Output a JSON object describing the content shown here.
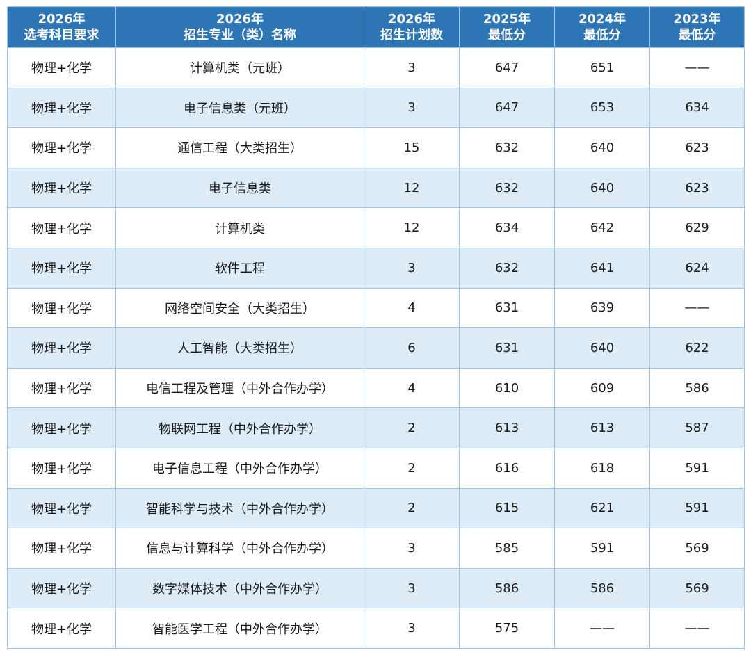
{
  "table": {
    "headers": [
      {
        "line1": "2026年",
        "line2": "选考科目要求"
      },
      {
        "line1": "2026年",
        "line2": "招生专业（类）名称"
      },
      {
        "line1": "2026年",
        "line2": "招生计划数"
      },
      {
        "line1": "2025年",
        "line2": "最低分"
      },
      {
        "line1": "2024年",
        "line2": "最低分"
      },
      {
        "line1": "2023年",
        "line2": "最低分"
      }
    ],
    "rows": [
      [
        "物理+化学",
        "计算机类（元班）",
        "3",
        "647",
        "651",
        "——"
      ],
      [
        "物理+化学",
        "电子信息类（元班）",
        "3",
        "647",
        "653",
        "634"
      ],
      [
        "物理+化学",
        "通信工程（大类招生）",
        "15",
        "632",
        "640",
        "623"
      ],
      [
        "物理+化学",
        "电子信息类",
        "12",
        "632",
        "640",
        "623"
      ],
      [
        "物理+化学",
        "计算机类",
        "12",
        "634",
        "642",
        "629"
      ],
      [
        "物理+化学",
        "软件工程",
        "3",
        "632",
        "641",
        "624"
      ],
      [
        "物理+化学",
        "网络空间安全（大类招生）",
        "4",
        "631",
        "639",
        "——"
      ],
      [
        "物理+化学",
        "人工智能（大类招生）",
        "6",
        "631",
        "640",
        "622"
      ],
      [
        "物理+化学",
        "电信工程及管理（中外合作办学）",
        "4",
        "610",
        "609",
        "586"
      ],
      [
        "物理+化学",
        "物联网工程（中外合作办学）",
        "2",
        "613",
        "613",
        "587"
      ],
      [
        "物理+化学",
        "电子信息工程（中外合作办学）",
        "2",
        "616",
        "618",
        "591"
      ],
      [
        "物理+化学",
        "智能科学与技术（中外合作办学）",
        "2",
        "615",
        "621",
        "591"
      ],
      [
        "物理+化学",
        "信息与计算科学（中外合作办学）",
        "3",
        "585",
        "591",
        "569"
      ],
      [
        "物理+化学",
        "数字媒体技术（中外合作办学）",
        "3",
        "586",
        "586",
        "569"
      ],
      [
        "物理+化学",
        "智能医学工程（中外合作办学）",
        "3",
        "575",
        "——",
        "——"
      ]
    ]
  },
  "colors": {
    "header_bg": "#2e75b6",
    "header_text": "#ffffff",
    "stripe_bg": "#ddebf7",
    "border": "#9dc3e6"
  }
}
